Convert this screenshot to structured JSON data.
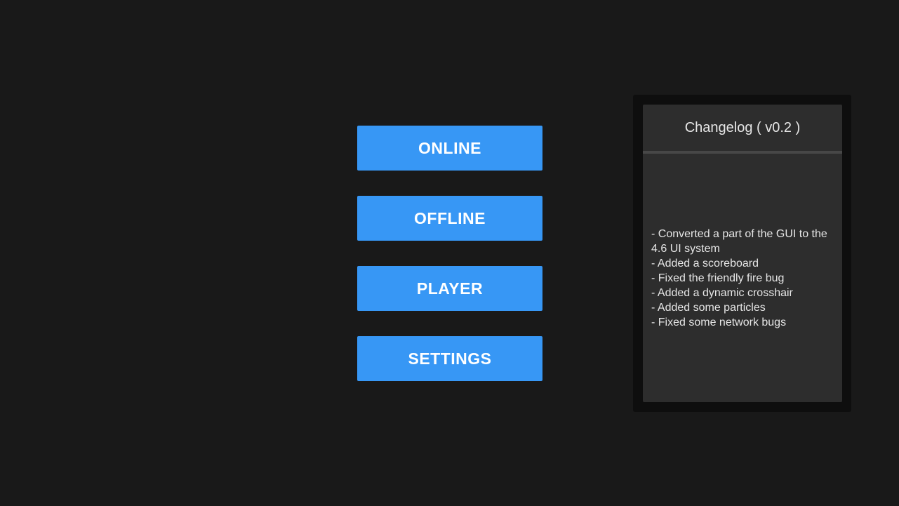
{
  "menu": {
    "buttons": [
      {
        "label": "ONLINE"
      },
      {
        "label": "OFFLINE"
      },
      {
        "label": "PLAYER"
      },
      {
        "label": "SETTINGS"
      }
    ]
  },
  "changelog": {
    "title": "Changelog ( v0.2 )",
    "entries": [
      "- Converted a part of the GUI to the 4.6 UI system",
      "- Added a scoreboard",
      "- Fixed the friendly fire bug",
      "- Added a dynamic crosshair",
      "- Added some particles",
      "- Fixed some network bugs"
    ]
  },
  "colors": {
    "background": "#191919",
    "button": "#3797f5",
    "button_text": "#ffffff",
    "panel": "#2d2d2d",
    "panel_frame": "#0e0e0e",
    "panel_text": "#e6e6e6"
  }
}
